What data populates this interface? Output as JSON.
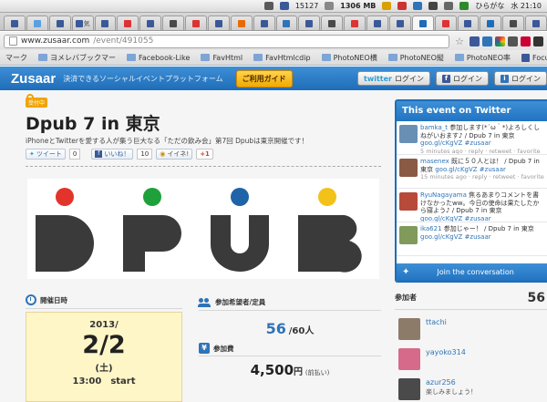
{
  "menubar": {
    "number": "15127",
    "memory": "1306 MB",
    "input": "ひらがな",
    "clock": "水 21:10"
  },
  "tabs": [
    {
      "label": "",
      "color": "#3b5998"
    },
    {
      "label": "",
      "color": "#5aa0e0"
    },
    {
      "label": "",
      "color": "#3b5998"
    },
    {
      "label": "気",
      "color": "#3b5998"
    },
    {
      "label": "",
      "color": "#3b5998"
    },
    {
      "label": "",
      "color": "#d33"
    },
    {
      "label": "",
      "color": "#3b5998"
    },
    {
      "label": "",
      "color": "#4a4a4a"
    },
    {
      "label": "",
      "color": "#d33"
    },
    {
      "label": "",
      "color": "#3b5998"
    },
    {
      "label": "",
      "color": "#e96b00"
    },
    {
      "label": "",
      "color": "#3b5998"
    },
    {
      "label": "",
      "color": "#2f74b8"
    },
    {
      "label": "",
      "color": "#3b5998"
    },
    {
      "label": "",
      "color": "#4a4a4a"
    },
    {
      "label": "",
      "color": "#d33"
    },
    {
      "label": "",
      "color": "#3b5998"
    },
    {
      "label": "",
      "color": "#3b5998"
    },
    {
      "label": "",
      "color": "#1f6db8"
    },
    {
      "label": "",
      "color": "#d33"
    },
    {
      "label": "",
      "color": "#3b5998"
    },
    {
      "label": "",
      "color": "#1f6db8"
    },
    {
      "label": "",
      "color": "#4a4a4a"
    },
    {
      "label": "",
      "color": "#3b5998"
    }
  ],
  "address": {
    "host": "www.zusaar.com",
    "path": "/event/491055"
  },
  "bookmarks": [
    {
      "label": "マーク",
      "type": "text"
    },
    {
      "label": "ヨメレバブックマー",
      "type": "folder"
    },
    {
      "label": "Facebook-Like",
      "type": "folder"
    },
    {
      "label": "FavHtml",
      "type": "folder"
    },
    {
      "label": "FavHtmlcdip",
      "type": "folder"
    },
    {
      "label": "PhotoNEO横",
      "type": "folder"
    },
    {
      "label": "PhotoNEO縦",
      "type": "folder"
    },
    {
      "label": "PhotoNEO率",
      "type": "folder"
    },
    {
      "label": "FocusHtmlNEO",
      "type": "fb"
    }
  ],
  "site": {
    "logo": "Zusaar",
    "tagline": "決済できるソーシャルイベントプラットフォーム",
    "guide": "ご利用ガイド",
    "login_twitter_brand": "twitter",
    "login_twitter": "ログイン",
    "login_facebook": "ログイン",
    "login_other": "ログイン"
  },
  "event": {
    "badge": "受付中",
    "title": "Dpub 7 in 東京",
    "subtitle": "iPhoneとTwitterを愛する人が集う巨大なる「ただの飲み会」第7回 Dpubは東京開催です！",
    "tweet_label": "ツイート",
    "tweet_count": "0",
    "like_label": "いいね！",
    "like_count": "10",
    "iine_label": "イイネ!",
    "gplus_label": "+1"
  },
  "banner": {
    "letters": [
      "D",
      "P",
      "U",
      "B"
    ],
    "dot_colors": [
      "#e2342b",
      "#1ea03a",
      "#1f63a8",
      "#f2c21a"
    ],
    "letter_color": "#3a3a3a"
  },
  "schedule": {
    "heading": "開催日時",
    "year": "2013/",
    "date": "2/2",
    "weekday": "(土)",
    "time": "13:00　start"
  },
  "capacity": {
    "heading": "参加希望者/定員",
    "applicants": "56",
    "limit": "/60人"
  },
  "fee": {
    "heading": "参加費",
    "amount": "4,500",
    "unit": "円",
    "note": "(前払い)"
  },
  "twitter_panel": {
    "heading": "This event on Twitter",
    "footer": "Join the conversation",
    "tweets": [
      {
        "user": "bamka_t",
        "text": " 参加します(*´ω｀*)よろしくしねがいおます♪ / Dpub 7 in 東京 ",
        "link": "goo.gl/cKgVZ #zusaar",
        "meta": "5 minutes ago · reply · retweet · favorite",
        "avatar": "#6a8fb5"
      },
      {
        "user": "masenex",
        "text": " 既に５０人とは！ / Dpub 7 in 東京 ",
        "link": "goo.gl/cKgVZ #zusaar",
        "meta": "15 minutes ago · reply · retweet · favorite",
        "avatar": "#8a5a44"
      },
      {
        "user": "RyuNagayama",
        "text": " 焦るあまりコメントを書けなかったww。今日の使命は果たしたから寝よう♪ / Dpub 7 in 東京 ",
        "link": "goo.gl/cKgVZ #zusaar",
        "meta": "59 seconds ago · reply · retweet · favorite",
        "avatar": "#b84a3a"
      },
      {
        "user": "ika621",
        "text": " 参加じゃー！ / Dpub 7 in 東京 ",
        "link": "goo.gl/cKgVZ #zusaar",
        "meta": "",
        "avatar": "#7f9a5a"
      }
    ]
  },
  "participants": {
    "heading": "参加者",
    "count": "56",
    "items": [
      {
        "name": "ttachi",
        "message": "",
        "avatar": "#8d7b6a"
      },
      {
        "name": "yayoko314",
        "message": "",
        "avatar": "#d66a8a"
      },
      {
        "name": "azur256",
        "message": "楽しみましょう！",
        "avatar": "#4a4a4a"
      }
    ]
  }
}
